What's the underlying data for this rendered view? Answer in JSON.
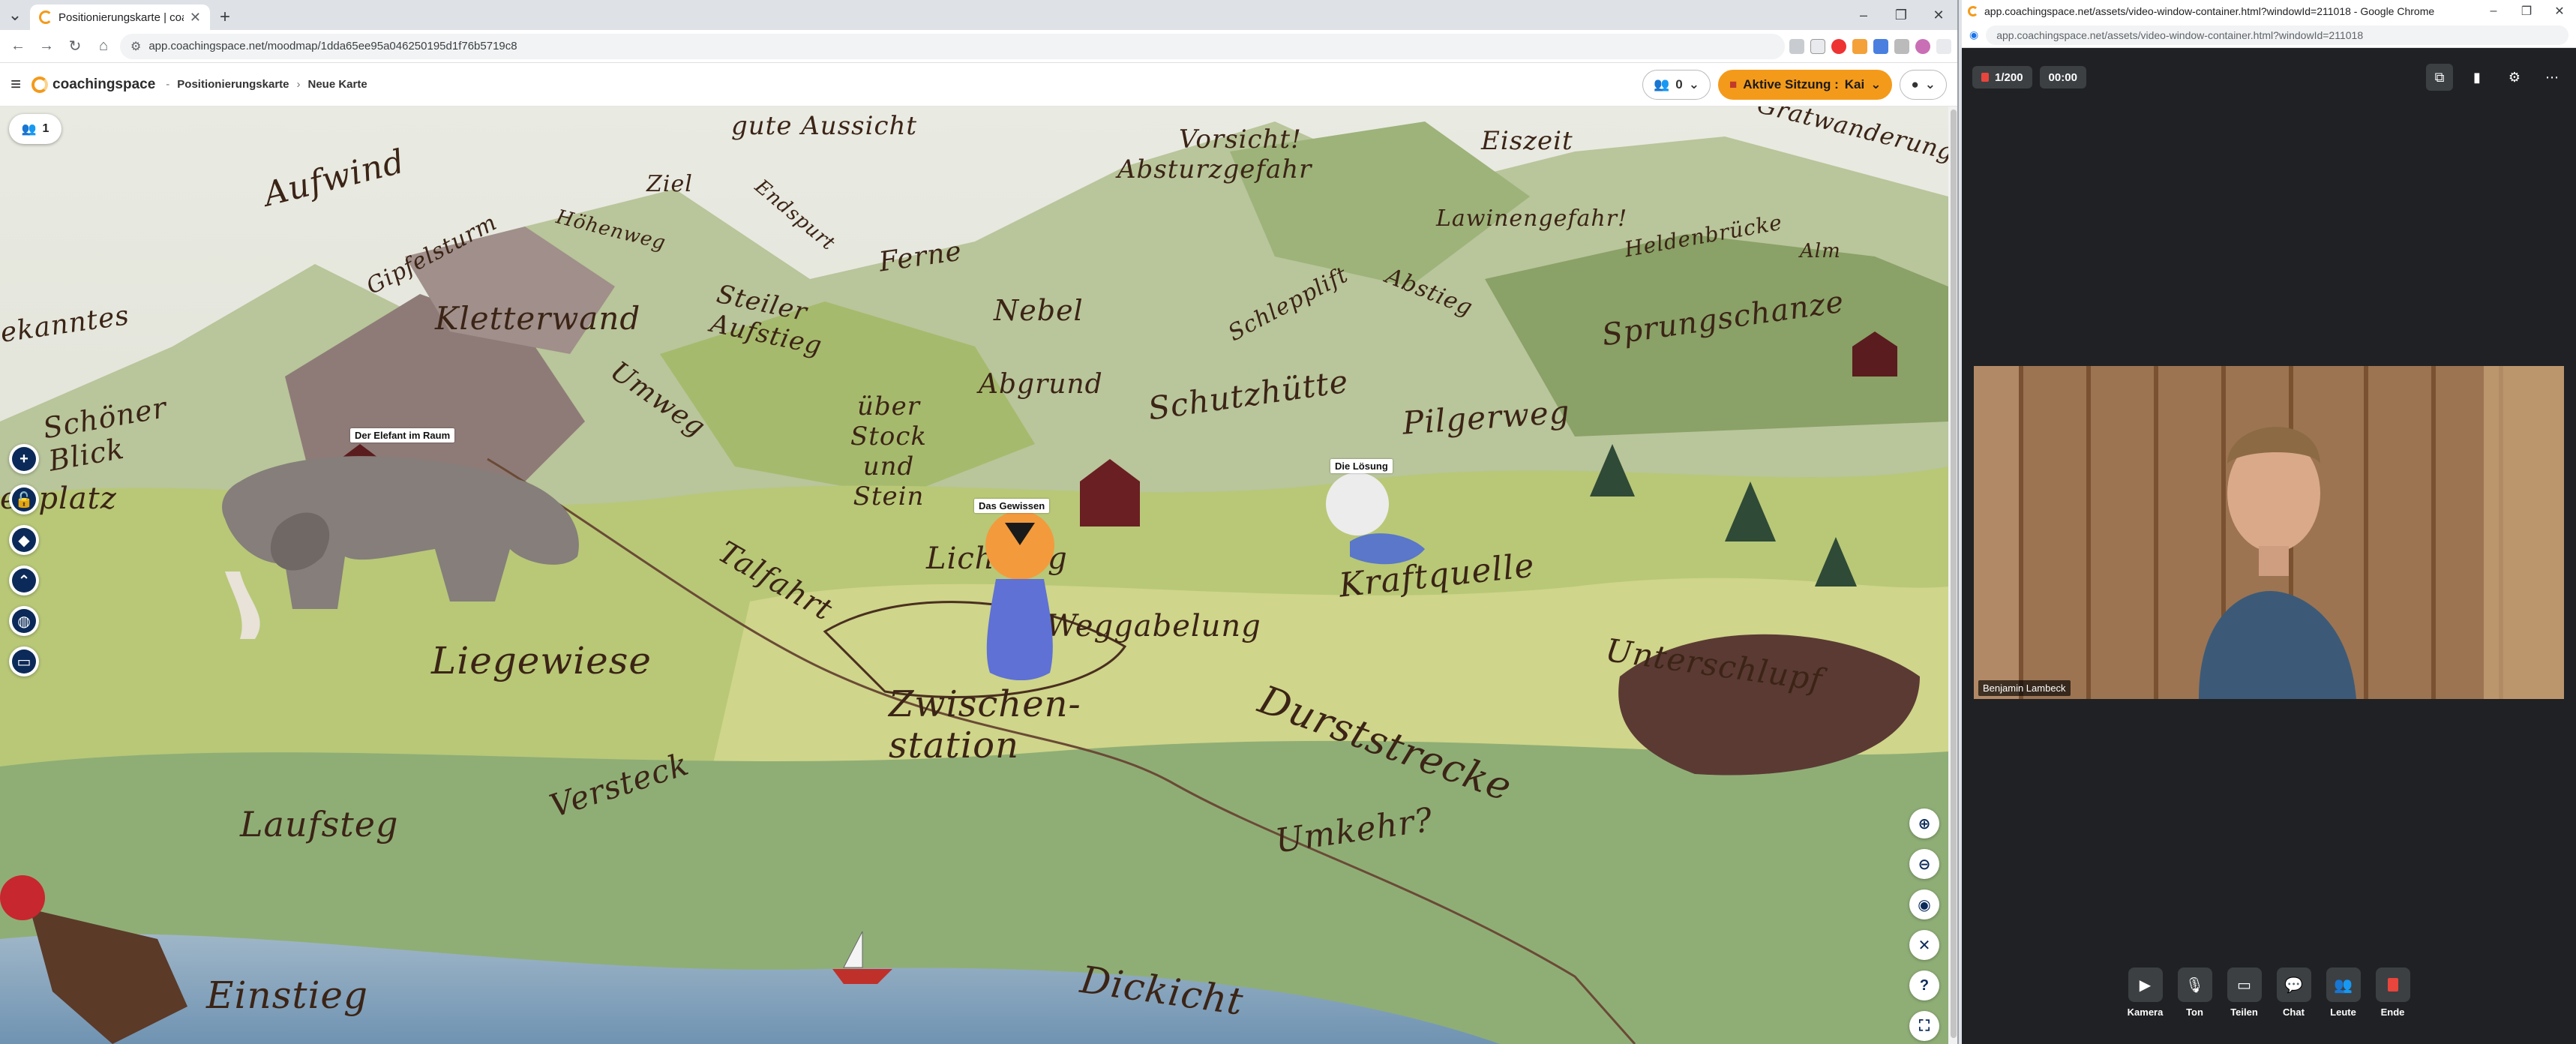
{
  "main_window": {
    "tab_title": "Positionierungskarte | coaching",
    "url": "app.coachingspace.net/moodmap/1dda65ee95a046250195d1f76b5719c8",
    "window_controls": [
      "–",
      "❐",
      "✕"
    ]
  },
  "app_header": {
    "logo_text": "coachingspace",
    "breadcrumb": [
      "Positionierungskarte",
      "Neue Karte"
    ],
    "participants_count": "0",
    "session_label": "Aktive Sitzung :",
    "session_user": "Kai"
  },
  "map": {
    "user_count": "1",
    "figure_labels": {
      "elefant": "Der Elefant im Raum",
      "gewissen": "Das Gewissen",
      "loesung": "Die Lösung"
    },
    "words": {
      "gute_aussicht": "gute Aussicht",
      "vorsicht": "Vorsicht!",
      "absturzgefahr": "Absturzgefahr",
      "eiszeit": "Eiszeit",
      "gratwanderung": "Gratwanderung",
      "aufwind": "Aufwind",
      "ziel": "Ziel",
      "endspurt": "Endspurt",
      "lawinengefahr": "Lawinengefahr!",
      "heldenbruecke": "Heldenbrücke",
      "alm": "Alm",
      "hoehenweg": "Höhenweg",
      "gipfelsturm": "Gipfelsturm",
      "ferne": "Ferne",
      "nebel": "Nebel",
      "schlepplift": "Schlepplift",
      "abstieg": "Abstieg",
      "unbekanntes": "ekanntes",
      "kletterwand": "Kletterwand",
      "steiler_aufstieg": "Steiler Aufstieg",
      "sprungschanze": "Sprungschanze",
      "umweg": "Umweg",
      "abgrund": "Abgrund",
      "schutzhuette": "Schutzhütte",
      "pilgerweg": "Pilgerweg",
      "schoener_blick": "Schöner Blick",
      "ueber_stock": "über Stock und Stein",
      "rastplatz": "enplatz",
      "lichtung": "Lichtung",
      "talfahrt": "Talfahrt",
      "kraftquelle": "Kraftquelle",
      "weggabelung": "Weggabelung",
      "liegewiese": "Liegewiese",
      "unterschlupf": "Unterschlupf",
      "zwischenstation": "Zwischen- station",
      "durststrecke": "Durststrecke",
      "versteck": "Versteck",
      "laufsteg": "Laufsteg",
      "umkehr": "Umkehr?",
      "einstieg": "Einstieg",
      "dickicht": "Dickicht"
    }
  },
  "video_window": {
    "title": "app.coachingspace.net/assets/video-window-container.html?windowId=211018 - Google Chrome",
    "url": "app.coachingspace.net/assets/video-window-container.html?windowId=211018",
    "counter": "1/200",
    "timer": "00:00",
    "participant_name": "Benjamin Lambeck",
    "controls": [
      "Kamera",
      "Ton",
      "Teilen",
      "Chat",
      "Leute",
      "Ende"
    ]
  },
  "colors": {
    "accent": "#f49a1a",
    "navy": "#0b2a59",
    "video_bg": "#202124"
  }
}
